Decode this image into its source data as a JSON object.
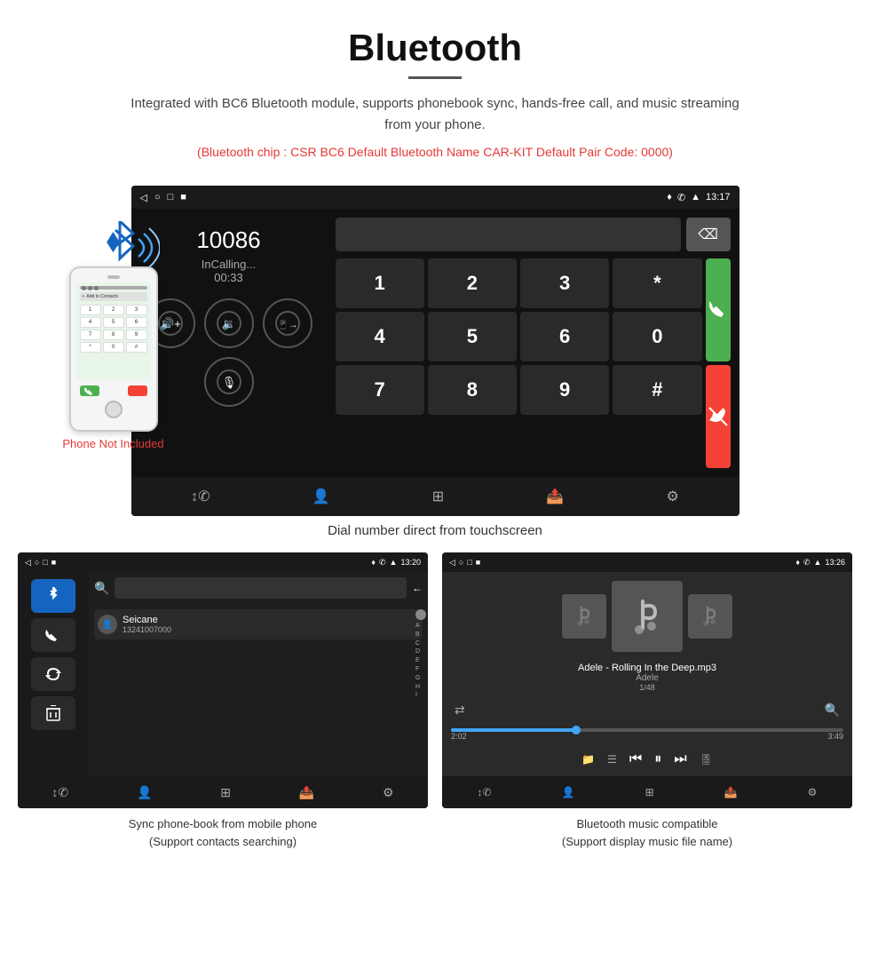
{
  "header": {
    "title": "Bluetooth",
    "subtitle": "Integrated with BC6 Bluetooth module, supports phonebook sync, hands-free call, and music streaming from your phone.",
    "spec": "(Bluetooth chip : CSR BC6    Default Bluetooth Name CAR-KIT    Default Pair Code: 0000)"
  },
  "phone_illustration": {
    "not_included_label": "Phone Not Included"
  },
  "dial_screen": {
    "status_time": "13:17",
    "caller_number": "10086",
    "calling_label": "InCalling...",
    "timer": "00:33",
    "keys": [
      "1",
      "2",
      "3",
      "4",
      "5",
      "6",
      "7",
      "8",
      "9",
      "*",
      "0",
      "#"
    ],
    "green_btn": "✆",
    "red_btn": "✆"
  },
  "main_caption": "Dial number direct from touchscreen",
  "phonebook_screen": {
    "status_time": "13:20",
    "contact_name": "Seicane",
    "contact_number": "13241007000",
    "alphabet": [
      "A",
      "B",
      "C",
      "D",
      "E",
      "F",
      "G",
      "H",
      "I"
    ]
  },
  "music_screen": {
    "status_time": "13:26",
    "song_title": "Adele - Rolling In the Deep.mp3",
    "artist": "Adele",
    "track_num": "1/48",
    "time_current": "2:02",
    "time_total": "3:49",
    "progress_percent": 32
  },
  "bottom_captions": {
    "phonebook": "Sync phone-book from mobile phone\n(Support contacts searching)",
    "music": "Bluetooth music compatible\n(Support display music file name)"
  }
}
